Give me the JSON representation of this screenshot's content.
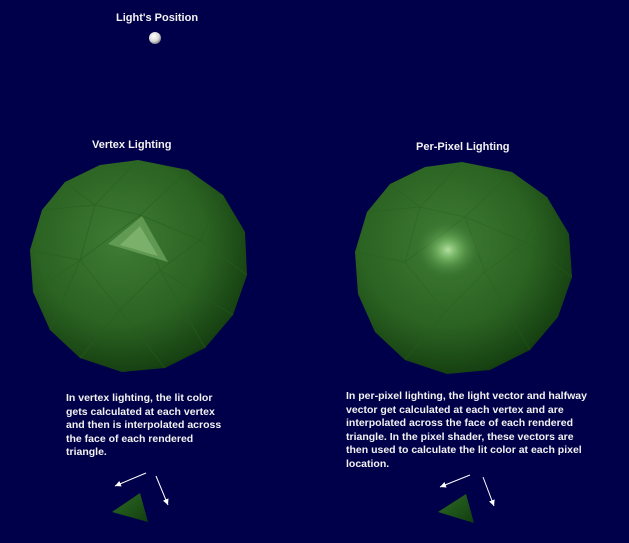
{
  "light": {
    "title": "Light's Position"
  },
  "vertex": {
    "title": "Vertex Lighting",
    "lines": [
      "In vertex lighting, the lit color",
      "gets calculated at each vertex",
      "and then is interpolated across",
      "the face of each rendered",
      "triangle."
    ]
  },
  "perpixel": {
    "title": "Per-Pixel Lighting",
    "lines": [
      "In per-pixel lighting, the light vector and halfway",
      "vector get calculated at each vertex and are",
      "interpolated across the face of each rendered",
      "triangle.  In the pixel shader, these vectors are",
      "then used to calculate the lit color at each pixel",
      "location."
    ]
  },
  "colors": {
    "background": "#00004a",
    "sphere": "#2f6b26",
    "triangle": "#1e5a1a",
    "text": "#f2f2f2"
  }
}
